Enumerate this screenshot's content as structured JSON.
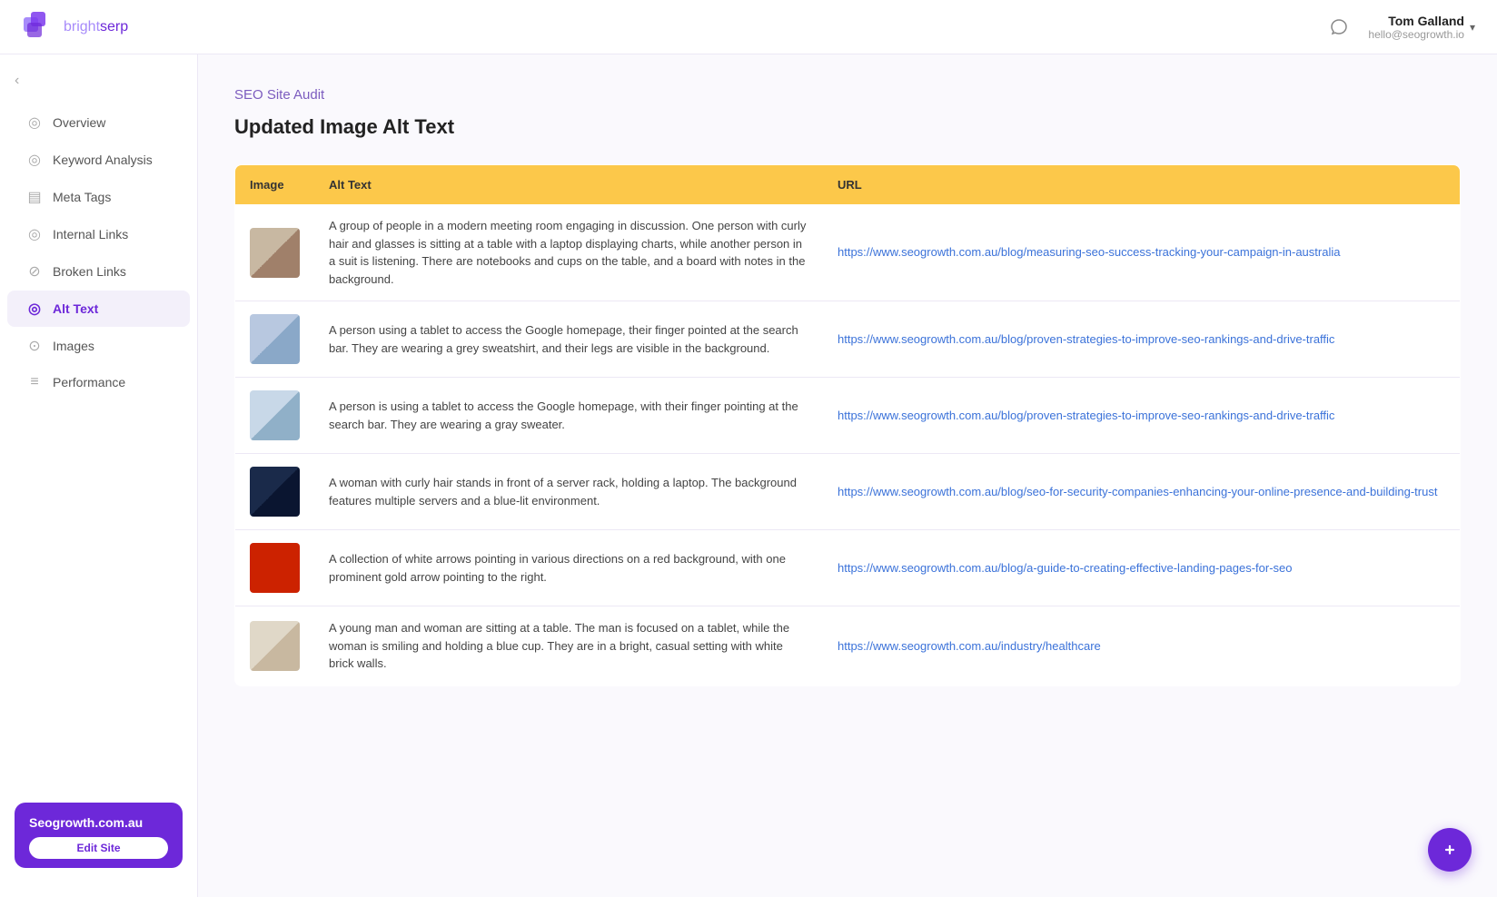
{
  "header": {
    "logo_bright": "bright",
    "logo_serp": "serp",
    "user_name": "Tom Galland",
    "user_email": "hello@seogrowth.io"
  },
  "sidebar": {
    "collapse_icon": "‹",
    "items": [
      {
        "label": "Overview",
        "icon": "circle-dot",
        "id": "overview"
      },
      {
        "label": "Keyword Analysis",
        "icon": "circle-dot",
        "id": "keyword-analysis"
      },
      {
        "label": "Meta Tags",
        "icon": "square-list",
        "id": "meta-tags"
      },
      {
        "label": "Internal Links",
        "icon": "circle-dot",
        "id": "internal-links"
      },
      {
        "label": "Broken Links",
        "icon": "broken-link",
        "id": "broken-links"
      },
      {
        "label": "Alt Text",
        "icon": "circle-dot",
        "id": "alt-text",
        "active": true
      },
      {
        "label": "Images",
        "icon": "camera",
        "id": "images"
      },
      {
        "label": "Performance",
        "icon": "three-lines",
        "id": "performance"
      }
    ],
    "site_name": "Seogrowth.com.au",
    "edit_btn": "Edit Site"
  },
  "main": {
    "section_label": "SEO Site Audit",
    "page_title": "Updated Image Alt Text",
    "table": {
      "columns": [
        "Image",
        "Alt Text",
        "URL"
      ],
      "rows": [
        {
          "thumb_class": "thumb-meeting",
          "alt_text": "A group of people in a modern meeting room engaging in discussion. One person with curly hair and glasses is sitting at a table with a laptop displaying charts, while another person in a suit is listening. There are notebooks and cups on the table, and a board with notes in the background.",
          "url": "https://www.seogrowth.com.au/blog/measuring-seo-success-tracking-your-campaign-in-australia"
        },
        {
          "thumb_class": "thumb-tablet",
          "alt_text": "A person using a tablet to access the Google homepage, their finger pointed at the search bar. They are wearing a grey sweatshirt, and their legs are visible in the background.",
          "url": "https://www.seogrowth.com.au/blog/proven-strategies-to-improve-seo-rankings-and-drive-traffic"
        },
        {
          "thumb_class": "thumb-tablet2",
          "alt_text": "A person is using a tablet to access the Google homepage, with their finger pointing at the search bar. They are wearing a gray sweater.",
          "url": "https://www.seogrowth.com.au/blog/proven-strategies-to-improve-seo-rankings-and-drive-traffic"
        },
        {
          "thumb_class": "thumb-server",
          "alt_text": "A woman with curly hair stands in front of a server rack, holding a laptop. The background features multiple servers and a blue-lit environment.",
          "url": "https://www.seogrowth.com.au/blog/seo-for-security-companies-enhancing-your-online-presence-and-building-trust"
        },
        {
          "thumb_class": "thumb-arrows",
          "alt_text": "A collection of white arrows pointing in various directions on a red background, with one prominent gold arrow pointing to the right.",
          "url": "https://www.seogrowth.com.au/blog/a-guide-to-creating-effective-landing-pages-for-seo"
        },
        {
          "thumb_class": "thumb-people",
          "alt_text": "A young man and woman are sitting at a table. The man is focused on a tablet, while the woman is smiling and holding a blue cup. They are in a bright, casual setting with white brick walls.",
          "url": "https://www.seogrowth.com.au/industry/healthcare"
        }
      ]
    }
  }
}
